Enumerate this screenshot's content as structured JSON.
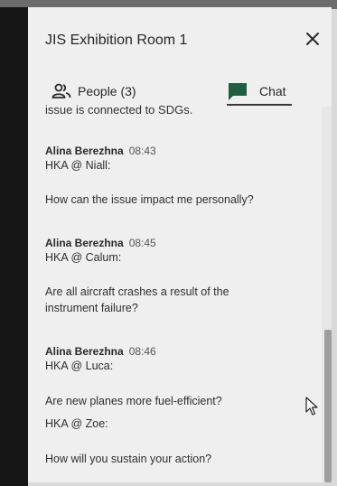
{
  "header": {
    "title": "JIS Exhibition Room 1",
    "tabs": {
      "people": "People (3)",
      "chat": "Chat"
    }
  },
  "chat": {
    "cut_off_line": "issue is connected to SDGs.",
    "messages": [
      {
        "author": "Alina Berezhna",
        "time": "08:43",
        "to": "HKA @ Niall:",
        "text": "How can the issue impact me personally?"
      },
      {
        "author": "Alina Berezhna",
        "time": "08:45",
        "to": "HKA @ Calum:",
        "text_line1": "Are all aircraft crashes a result of the",
        "text_line2": "instrument failure?"
      },
      {
        "author": "Alina Berezhna",
        "time": "08:46",
        "to": "HKA @ Luca:",
        "text": "Are new planes more fuel-efficient?"
      }
    ],
    "followup": {
      "to": "HKA @ Zoe:",
      "text": "How will you sustain your action?"
    }
  },
  "colors": {
    "panel_bg": "#efefef",
    "chat_icon": "#1f5e40",
    "frame": "#161616"
  }
}
